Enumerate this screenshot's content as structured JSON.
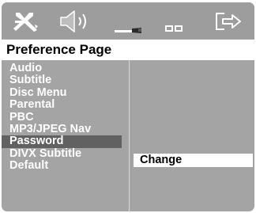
{
  "toolbar": {
    "icons": [
      "general-setup-icon",
      "audio-setup-icon",
      "video-setup-icon",
      "preference-setup-icon",
      "exit-icon"
    ]
  },
  "page": {
    "title": "Preference Page"
  },
  "menu": {
    "items": [
      {
        "label": "Audio"
      },
      {
        "label": "Subtitle"
      },
      {
        "label": "Disc Menu"
      },
      {
        "label": "Parental"
      },
      {
        "label": "PBC"
      },
      {
        "label": "MP3/JPEG Nav"
      },
      {
        "label": "Password",
        "selected": true
      },
      {
        "label": "DIVX Subtitle"
      },
      {
        "label": "Default"
      }
    ]
  },
  "submenu": {
    "options": [
      {
        "label": "Change",
        "selected": true
      }
    ]
  },
  "colors": {
    "background": "#a4a4a4",
    "top_bar": "#9d9d9d",
    "highlight": "#616161",
    "title_bar": "#ffffff",
    "text": "#ffffff"
  }
}
